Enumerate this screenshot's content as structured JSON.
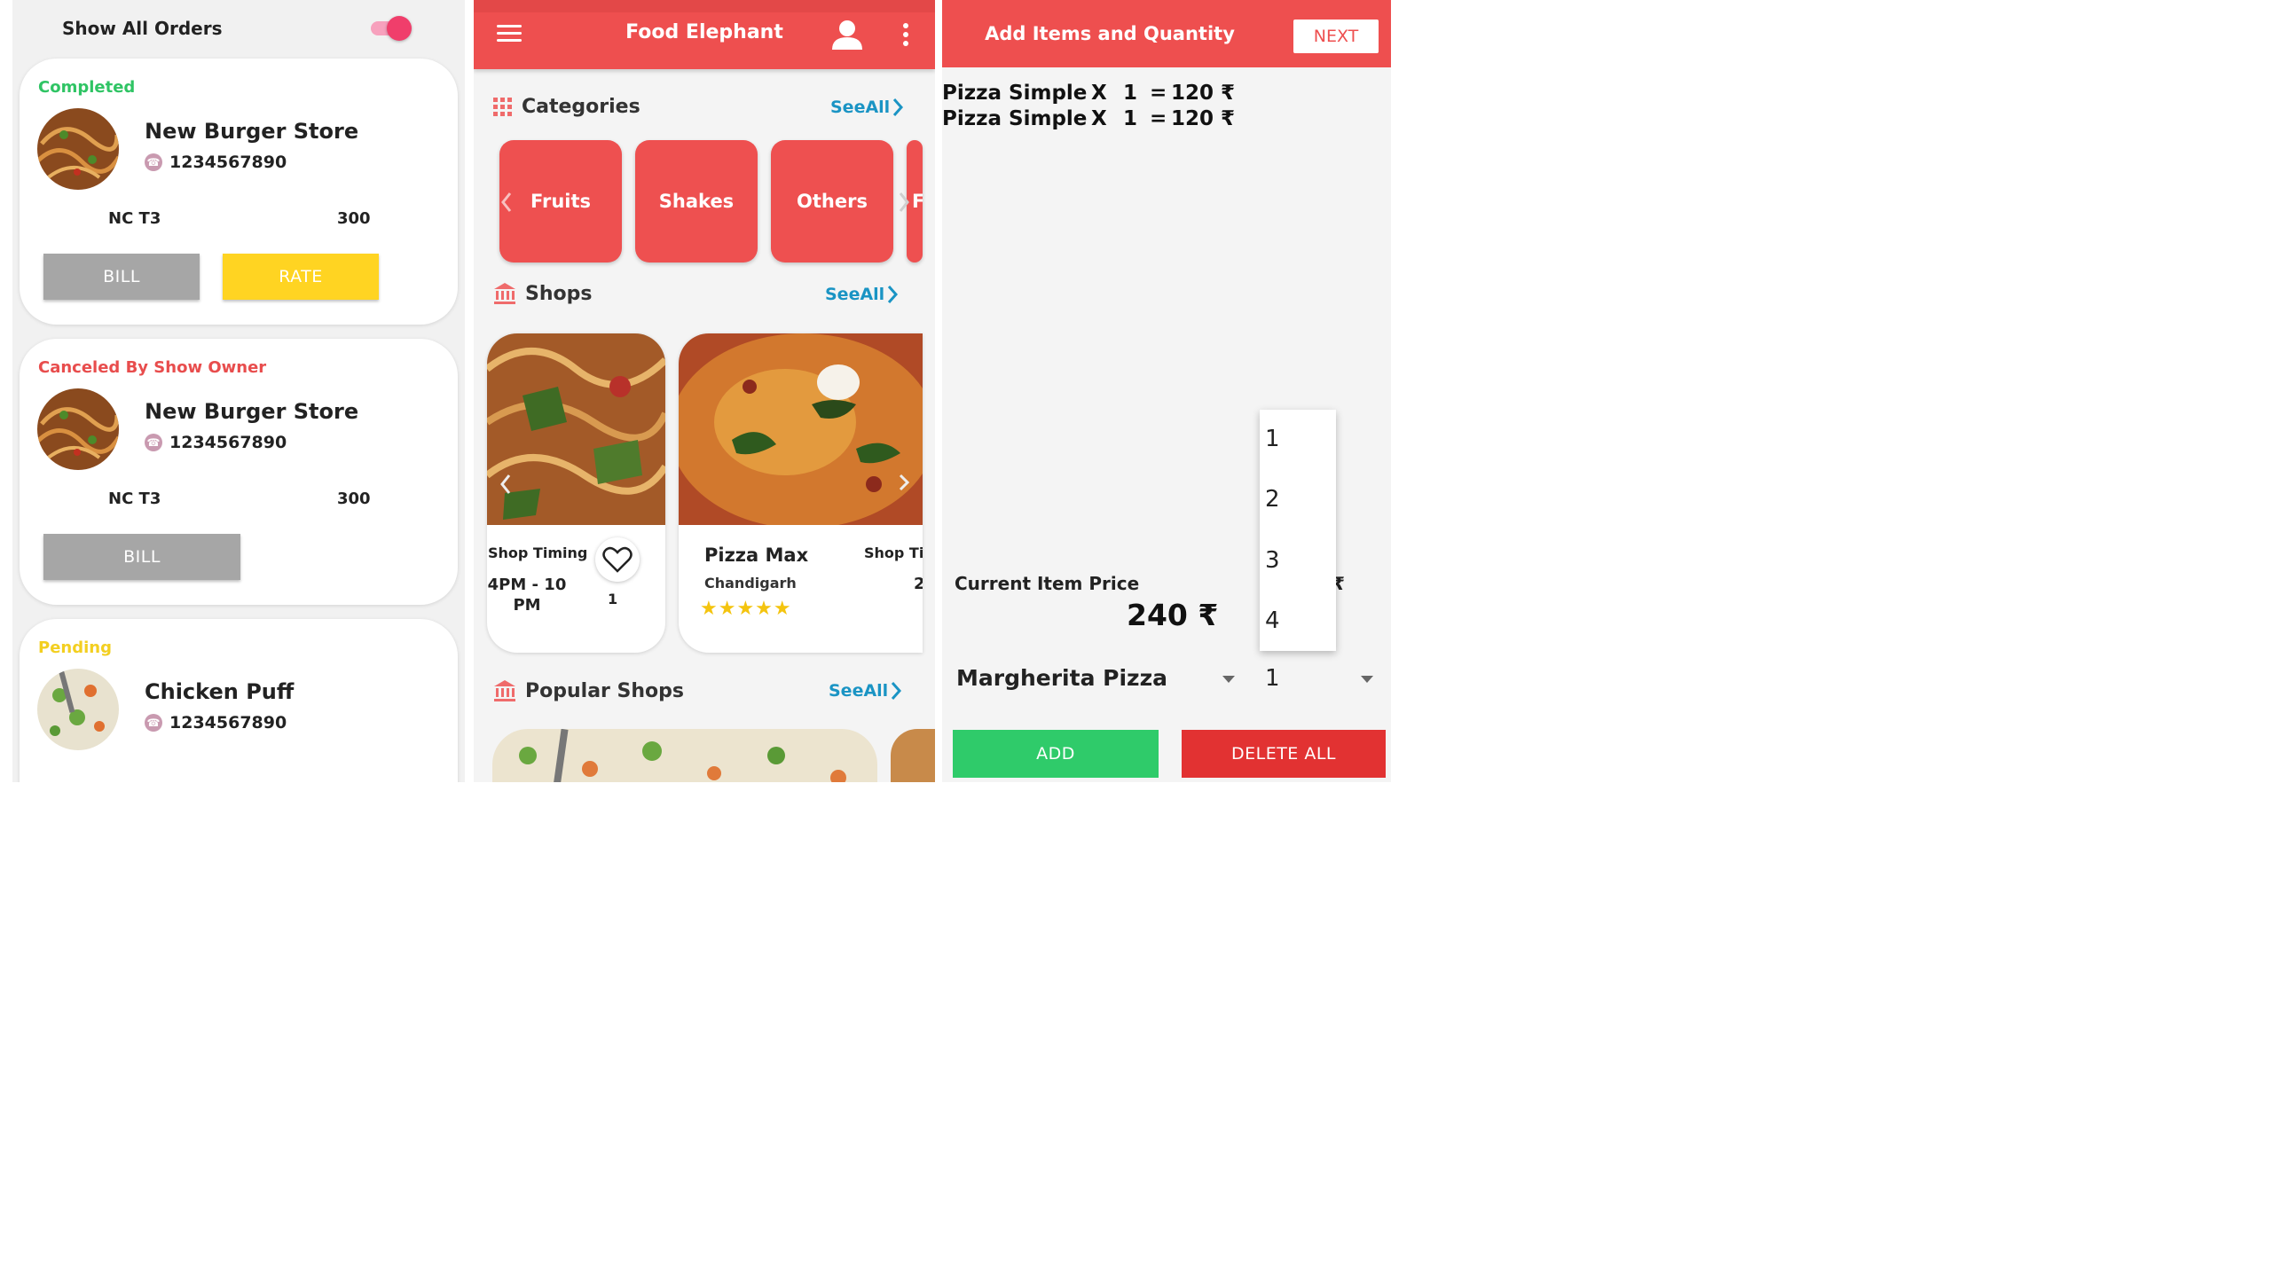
{
  "orders_screen": {
    "title": "Show All Orders",
    "orders": [
      {
        "status": "Completed",
        "status_color": "#2fc464",
        "shop": "New Burger Store",
        "phone": "1234567890",
        "code": "NC T3",
        "amount": "300",
        "buttons": [
          "BILL",
          "RATE"
        ]
      },
      {
        "status": "Canceled By Show Owner",
        "status_color": "#e84d4d",
        "shop": "New Burger Store",
        "phone": "1234567890",
        "code": "NC T3",
        "amount": "300",
        "buttons": [
          "BILL"
        ]
      },
      {
        "status": "Pending",
        "status_color": "#f3cf20",
        "shop": "Chicken Puff",
        "phone": "1234567890"
      }
    ]
  },
  "home_screen": {
    "app_title": "Food Elephant",
    "categories_label": "Categories",
    "shops_label": "Shops",
    "popular_label": "Popular Shops",
    "see_all": "SeeAll",
    "categories": [
      "Fruits",
      "Shakes",
      "Others",
      "F"
    ],
    "shops": [
      {
        "timing_label": "Shop Timing",
        "timing": "4PM - 10 PM",
        "likes": "1"
      },
      {
        "name": "Pizza Max",
        "city": "Chandigarh",
        "rating": 5,
        "timing_label": "Shop Tin",
        "timing_partial": "2"
      }
    ]
  },
  "cart_screen": {
    "title": "Add Items and Quantity",
    "next": "NEXT",
    "items": [
      {
        "name": "Pizza Simple",
        "x": "X",
        "qty": "1",
        "eq": "=",
        "price": "120 ₹"
      },
      {
        "name": "Pizza Simple",
        "x": "X",
        "qty": "1",
        "eq": "=",
        "price": "120 ₹"
      }
    ],
    "current_price_label": "Current Item Price",
    "current_price": "240 ₹",
    "hidden_symbol": "₹",
    "selected_item": "Margherita Pizza",
    "quantity_options": [
      "1",
      "2",
      "3",
      "4"
    ],
    "selected_quantity": "1",
    "add": "ADD",
    "delete_all": "DELETE ALL"
  },
  "colors": {
    "primary": "#ee4f4f",
    "bill": "#a6a6a6",
    "rate": "#ffd422",
    "add": "#2fcb6a",
    "delete": "#e23232",
    "link": "#1a94c4"
  }
}
